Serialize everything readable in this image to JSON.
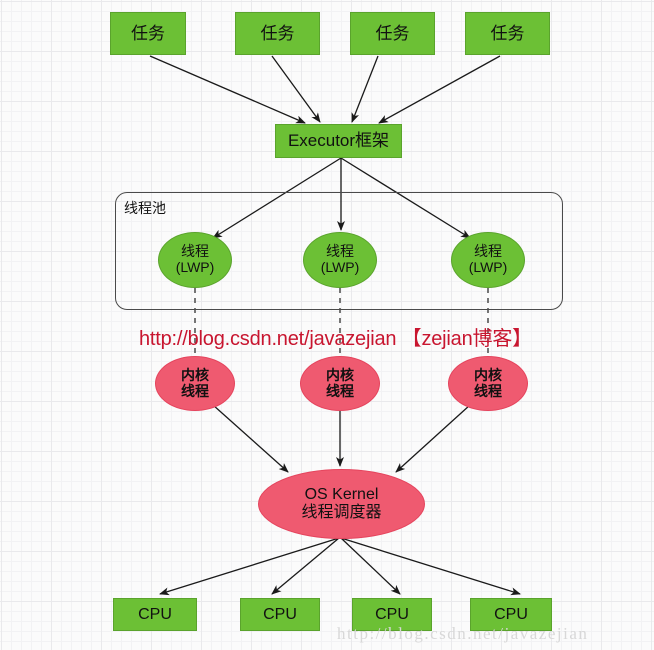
{
  "diagram": {
    "title": "Java Executor framework to OS kernel thread scheduling diagram",
    "colors": {
      "green_fill": "#6cc035",
      "green_stroke": "#5aa32c",
      "pink_fill": "#ef5a70",
      "pink_stroke": "#e5445d",
      "edge": "#1a1a1a",
      "pool_border": "#4a4a4a",
      "red_watermark": "#c8152f",
      "gray_watermark": "#d8d8d8",
      "grid_minor": "#f2f2f4",
      "grid_major": "#e9e9ec"
    },
    "tasks": [
      {
        "label": "任务"
      },
      {
        "label": "任务"
      },
      {
        "label": "任务"
      },
      {
        "label": "任务"
      }
    ],
    "executor": {
      "label": "Executor框架"
    },
    "pool": {
      "label": "线程池"
    },
    "threads": [
      {
        "label": "线程\n(LWP)"
      },
      {
        "label": "线程\n(LWP)"
      },
      {
        "label": "线程\n(LWP)"
      }
    ],
    "kernel_threads": [
      {
        "label": "内核\n线程"
      },
      {
        "label": "内核\n线程"
      },
      {
        "label": "内核\n线程"
      }
    ],
    "os_kernel": {
      "label": "OS Kernel\n线程调度器"
    },
    "cpus": [
      {
        "label": "CPU"
      },
      {
        "label": "CPU"
      },
      {
        "label": "CPU"
      },
      {
        "label": "CPU"
      }
    ],
    "watermarks": {
      "red": "http://blog.csdn.net/javazejian 【zejian博客】",
      "gray": "http://blog.csdn.net/javazejian"
    }
  }
}
